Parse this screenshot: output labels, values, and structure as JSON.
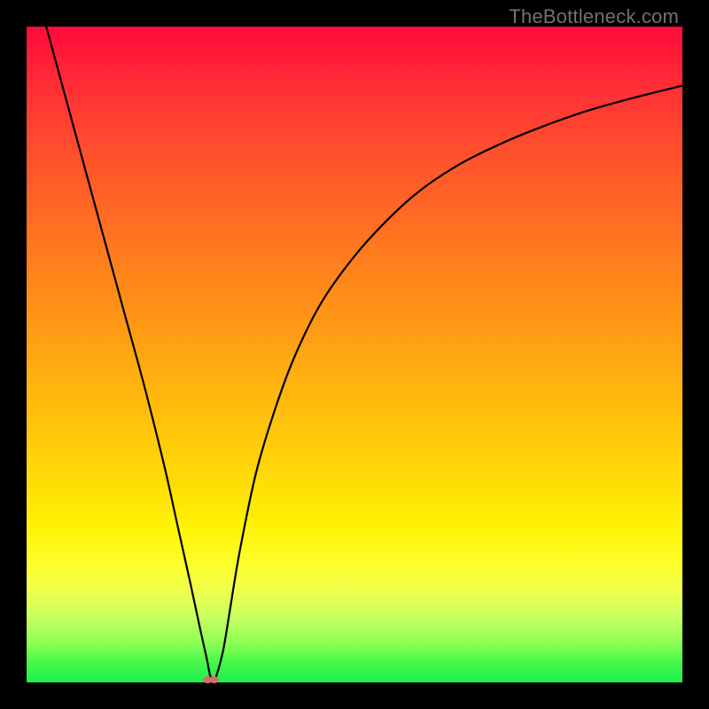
{
  "watermark": "TheBottleneck.com",
  "colors": {
    "frame": "#000000",
    "gradient_top": "#ff0a3a",
    "gradient_bottom": "#1bef4b",
    "curve": "#000000",
    "marker": "#d86a6a"
  },
  "chart_data": {
    "type": "line",
    "title": "",
    "xlabel": "",
    "ylabel": "",
    "xlim": [
      0,
      100
    ],
    "ylim": [
      0,
      100
    ],
    "grid": false,
    "legend": false,
    "annotations": [],
    "series": [
      {
        "name": "curve",
        "x": [
          3,
          6,
          9,
          12,
          15,
          18,
          21,
          23,
          25,
          26.5,
          27.5,
          28,
          28.5,
          29,
          30,
          31,
          32.5,
          35,
          38,
          41,
          45,
          50,
          55,
          60,
          66,
          72,
          78,
          85,
          92,
          100
        ],
        "y": [
          100,
          89,
          78,
          67,
          56,
          45,
          33,
          24,
          15,
          8,
          3.5,
          1,
          0.3,
          1.2,
          5,
          11,
          20,
          32,
          42,
          50,
          58,
          65,
          70.5,
          75,
          79,
          82,
          84.5,
          87,
          89,
          91
        ]
      }
    ],
    "markers": [
      {
        "name": "min-marker-1",
        "x": 27.6,
        "y": 0.4
      },
      {
        "name": "min-marker-2",
        "x": 28.6,
        "y": 0.4
      }
    ]
  }
}
